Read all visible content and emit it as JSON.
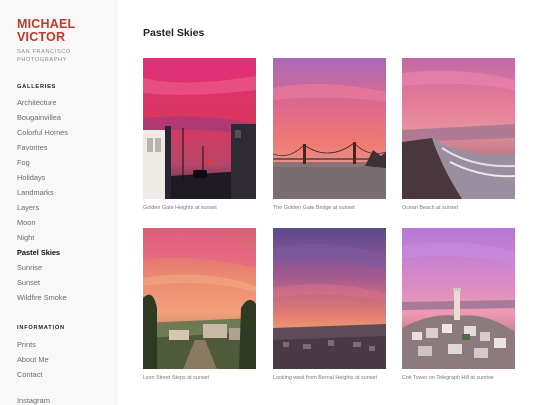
{
  "brand": {
    "name": "MICHAEL\nVICTOR",
    "tagline": "SAN FRANCISCO\nPHOTOGRAPHY"
  },
  "sidebar": {
    "galleries_heading": "GALLERIES",
    "galleries": [
      {
        "label": "Architecture"
      },
      {
        "label": "Bougainvillea"
      },
      {
        "label": "Colorful Homes"
      },
      {
        "label": "Favorites"
      },
      {
        "label": "Fog"
      },
      {
        "label": "Holidays"
      },
      {
        "label": "Landmarks"
      },
      {
        "label": "Layers"
      },
      {
        "label": "Moon"
      },
      {
        "label": "Night"
      },
      {
        "label": "Pastel Skies",
        "active": true
      },
      {
        "label": "Sunrise"
      },
      {
        "label": "Sunset"
      },
      {
        "label": "Wildfire Smoke"
      }
    ],
    "information_heading": "INFORMATION",
    "information": [
      {
        "label": "Prints"
      },
      {
        "label": "About Me"
      },
      {
        "label": "Contact"
      }
    ],
    "instagram": "Instagram"
  },
  "main": {
    "title": "Pastel Skies",
    "photos": [
      {
        "caption": "Golden Gate Heights at sunset"
      },
      {
        "caption": "The Golden Gate Bridge at sunset"
      },
      {
        "caption": "Ocean Beach at sunset"
      },
      {
        "caption": "Lyon Street Steps at sunset"
      },
      {
        "caption": "Looking west from Bernal Heights at sunset"
      },
      {
        "caption": "Coit Tower on Telegraph Hill at sunrise"
      }
    ]
  },
  "colors": {
    "brand": "#c0392b",
    "sidebar_bg": "#f8f8f8"
  }
}
